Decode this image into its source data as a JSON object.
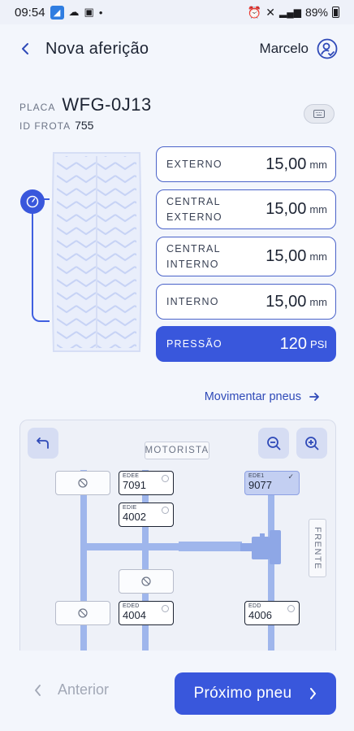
{
  "status_bar": {
    "time": "09:54",
    "battery": "89%"
  },
  "header": {
    "title": "Nova aferição",
    "user_name": "Marcelo"
  },
  "vehicle": {
    "plate_label": "PLACA",
    "plate": "WFG-0J13",
    "fleet_label": "ID FROTA",
    "fleet_id": "755"
  },
  "measurements": [
    {
      "label_line1": "EXTERNO",
      "label_line2": "",
      "value": "15,00",
      "unit": "mm"
    },
    {
      "label_line1": "CENTRAL",
      "label_line2": "EXTERNO",
      "value": "15,00",
      "unit": "mm"
    },
    {
      "label_line1": "CENTRAL",
      "label_line2": "INTERNO",
      "value": "15,00",
      "unit": "mm"
    },
    {
      "label_line1": "INTERNO",
      "label_line2": "",
      "value": "15,00",
      "unit": "mm"
    }
  ],
  "pressure": {
    "label": "PRESSÃO",
    "value": "120",
    "unit": "PSI"
  },
  "move_tires_link": "Movimentar pneus",
  "diagram": {
    "driver_label": "MOTORISTA",
    "front_label": "FRENTE",
    "tires": [
      {
        "position": "EDEE",
        "number": "7091",
        "selected": false
      },
      {
        "position": "EDIE",
        "number": "4002",
        "selected": false
      },
      {
        "position": "EDE1",
        "number": "9077",
        "selected": true
      },
      {
        "position": "EDED",
        "number": "4004",
        "selected": false
      },
      {
        "position": "EDD",
        "number": "4006",
        "selected": false
      }
    ]
  },
  "footer": {
    "previous_label": "Anterior",
    "next_label": "Próximo pneu"
  },
  "colors": {
    "primary": "#3957dc",
    "axle": "#9fb6ec",
    "background": "#f3f6fc"
  }
}
